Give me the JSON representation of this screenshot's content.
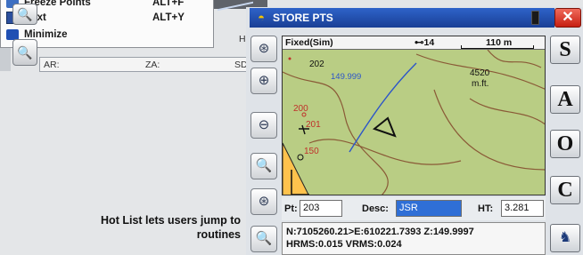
{
  "background_app": {
    "menu": {
      "items": [
        {
          "label": "Freeze Points",
          "shortcut": "ALT+F",
          "icon": "freeze-points-icon"
        },
        {
          "label": "Text",
          "shortcut": "ALT+Y",
          "icon": "text-icon"
        },
        {
          "label": "Minimize",
          "shortcut": "",
          "icon": "minimize-icon"
        }
      ]
    },
    "status": {
      "ar": "AR:",
      "za": "ZA:",
      "sd": "SD",
      "h": "H"
    }
  },
  "window": {
    "title": "STORE PTS",
    "close_label": "✕"
  },
  "map": {
    "mode": "Fixed(Sim)",
    "satellites": "⊷14",
    "scale": "110 m",
    "labels": {
      "pt202": "202",
      "elev": "149.999",
      "pt4520": "4520",
      "unit": "m.ft.",
      "pt200": "200",
      "pt201": "201",
      "pt150": "150"
    },
    "colors": {
      "terrain": "#b9cd84",
      "water": "#2c55c9",
      "contour": "#8a5a37",
      "zone": "#ffc24d"
    }
  },
  "fields": {
    "pt_label": "Pt:",
    "pt_value": "203",
    "desc_label": "Desc:",
    "desc_value": "JSR",
    "ht_label": "HT:",
    "ht_value": "3.281"
  },
  "coords": {
    "line1": "N:7105260.21>E:610221.7393 Z:149.9997",
    "line2": "HRMS:0.015 VRMS:0.024"
  },
  "right_keys": [
    "S",
    "A",
    "O",
    "C"
  ],
  "caption": "Hot List lets users jump to routines"
}
